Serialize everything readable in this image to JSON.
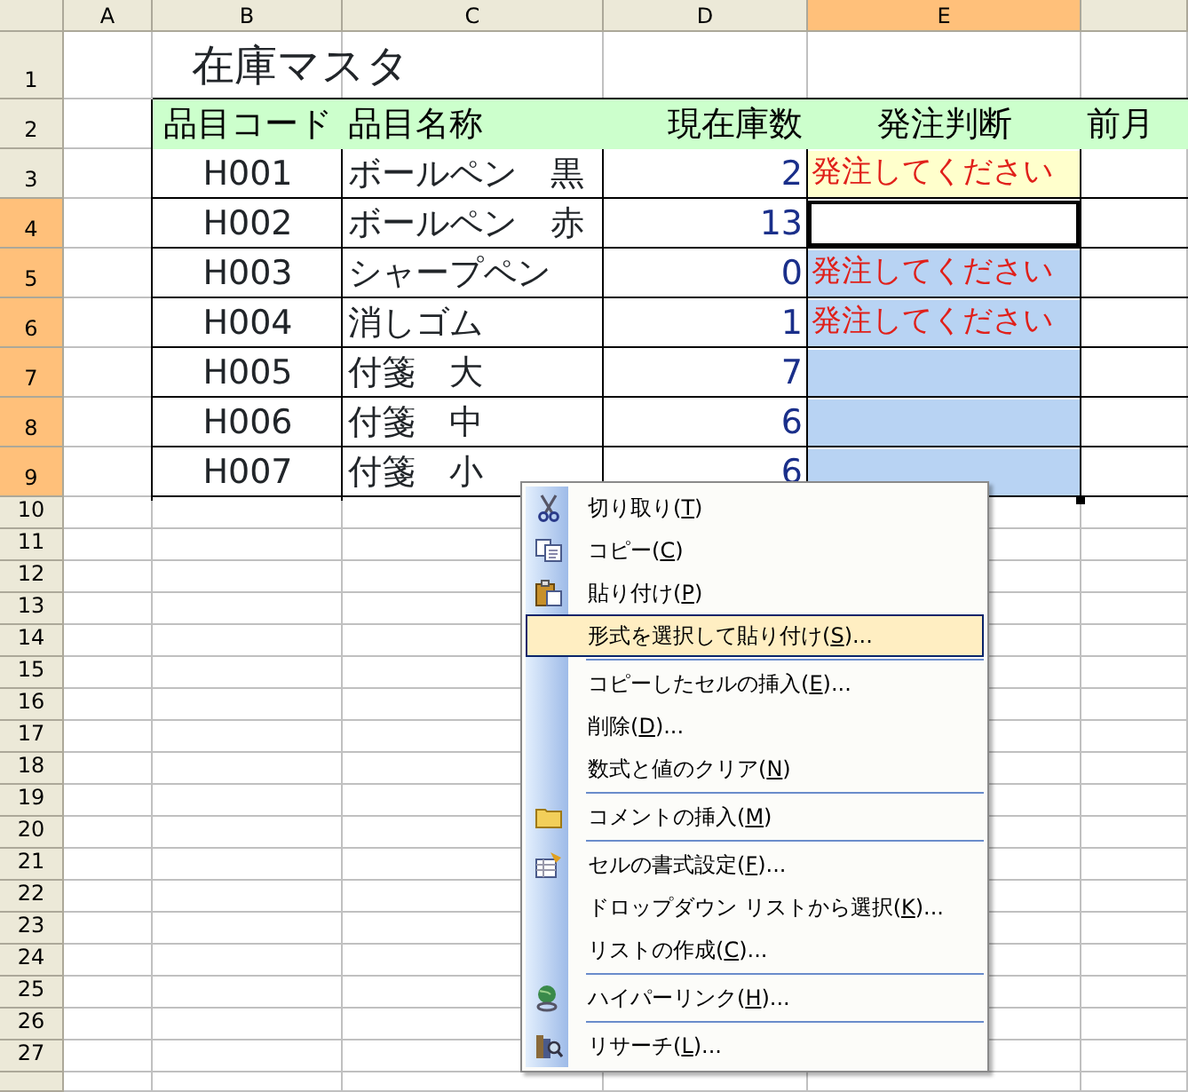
{
  "column_headers": [
    {
      "label": "A",
      "selected": false
    },
    {
      "label": "B",
      "selected": false
    },
    {
      "label": "C",
      "selected": false
    },
    {
      "label": "D",
      "selected": false
    },
    {
      "label": "E",
      "selected": true
    },
    {
      "selected": false
    }
  ],
  "row_headers": [
    {
      "label": "1",
      "selected": false
    },
    {
      "label": "2",
      "selected": false
    },
    {
      "label": "3",
      "selected": false
    },
    {
      "label": "4",
      "selected": true
    },
    {
      "label": "5",
      "selected": true
    },
    {
      "label": "6",
      "selected": true
    },
    {
      "label": "7",
      "selected": true
    },
    {
      "label": "8",
      "selected": true
    },
    {
      "label": "9",
      "selected": true
    },
    {
      "label": "10",
      "selected": false
    },
    {
      "label": "11",
      "selected": false
    },
    {
      "label": "12",
      "selected": false
    },
    {
      "label": "13",
      "selected": false
    },
    {
      "label": "14",
      "selected": false
    },
    {
      "label": "15",
      "selected": false
    },
    {
      "label": "16",
      "selected": false
    },
    {
      "label": "17",
      "selected": false
    },
    {
      "label": "18",
      "selected": false
    },
    {
      "label": "19",
      "selected": false
    },
    {
      "label": "20",
      "selected": false
    },
    {
      "label": "21",
      "selected": false
    },
    {
      "label": "22",
      "selected": false
    },
    {
      "label": "23",
      "selected": false
    },
    {
      "label": "24",
      "selected": false
    },
    {
      "label": "25",
      "selected": false
    },
    {
      "label": "26",
      "selected": false
    },
    {
      "label": "27",
      "selected": false
    }
  ],
  "sheet_title": "在庫マスタ",
  "table": {
    "columns": [
      "品目コード",
      "品目名称",
      "現在庫数",
      "発注判断",
      "前月"
    ],
    "rows": [
      {
        "code": "H001",
        "name": "ボールペン　黒",
        "stock": "2",
        "order": "発注してください",
        "highlighted": true,
        "selected": false,
        "active": false
      },
      {
        "code": "H002",
        "name": "ボールペン　赤",
        "stock": "13",
        "highlighted": false,
        "active": true
      },
      {
        "code": "H003",
        "name": "シャープペン",
        "stock": "0",
        "order": "発注してください",
        "highlighted": false,
        "selected": true,
        "active": false
      },
      {
        "code": "H004",
        "name": "消しゴム",
        "stock": "1",
        "order": "発注してください",
        "highlighted": false,
        "selected": true,
        "active": false
      },
      {
        "code": "H005",
        "name": "付箋　大",
        "stock": "7",
        "highlighted": false,
        "selected": true,
        "active": false
      },
      {
        "code": "H006",
        "name": "付箋　中",
        "stock": "6",
        "highlighted": false,
        "selected": true,
        "active": false
      },
      {
        "code": "H007",
        "name": "付箋　小",
        "stock": "6",
        "highlighted": false,
        "selected": true,
        "active": false
      }
    ]
  },
  "context_menu": [
    {
      "kind": "cut",
      "before": "切り取り(",
      "key": "T",
      "after": ")",
      "selected": false,
      "separator_before": false
    },
    {
      "kind": "copy",
      "before": "コピー(",
      "key": "C",
      "after": ")",
      "selected": false,
      "separator_before": false
    },
    {
      "kind": "paste",
      "before": "貼り付け(",
      "key": "P",
      "after": ")",
      "selected": false,
      "separator_before": false
    },
    {
      "kind": "plain",
      "before": "形式を選択して貼り付け(",
      "key": "S",
      "after": ")...",
      "selected": true,
      "separator_before": false
    },
    {
      "kind": "plain",
      "before": "コピーしたセルの挿入(",
      "key": "E",
      "after": ")...",
      "selected": false,
      "separator_before": true
    },
    {
      "kind": "plain",
      "before": "削除(",
      "key": "D",
      "after": ")...",
      "selected": false,
      "separator_before": false
    },
    {
      "kind": "plain",
      "before": "数式と値のクリア(",
      "key": "N",
      "after": ")",
      "selected": false,
      "separator_before": false
    },
    {
      "kind": "comment",
      "before": "コメントの挿入(",
      "key": "M",
      "after": ")",
      "selected": false,
      "separator_before": true
    },
    {
      "kind": "format",
      "before": "セルの書式設定(",
      "key": "F",
      "after": ")...",
      "selected": false,
      "separator_before": true
    },
    {
      "kind": "plain",
      "before": "ドロップダウン リストから選択(",
      "key": "K",
      "after": ")...",
      "selected": false,
      "separator_before": false
    },
    {
      "kind": "plain",
      "before": "リストの作成(",
      "key": "C",
      "after": ")...",
      "selected": false,
      "separator_before": false
    },
    {
      "kind": "link",
      "before": "ハイパーリンク(",
      "key": "H",
      "after": ")...",
      "selected": false,
      "separator_before": true
    },
    {
      "kind": "research",
      "before": "リサーチ(",
      "key": "L",
      "after": ")...",
      "selected": false,
      "separator_before": true
    }
  ]
}
